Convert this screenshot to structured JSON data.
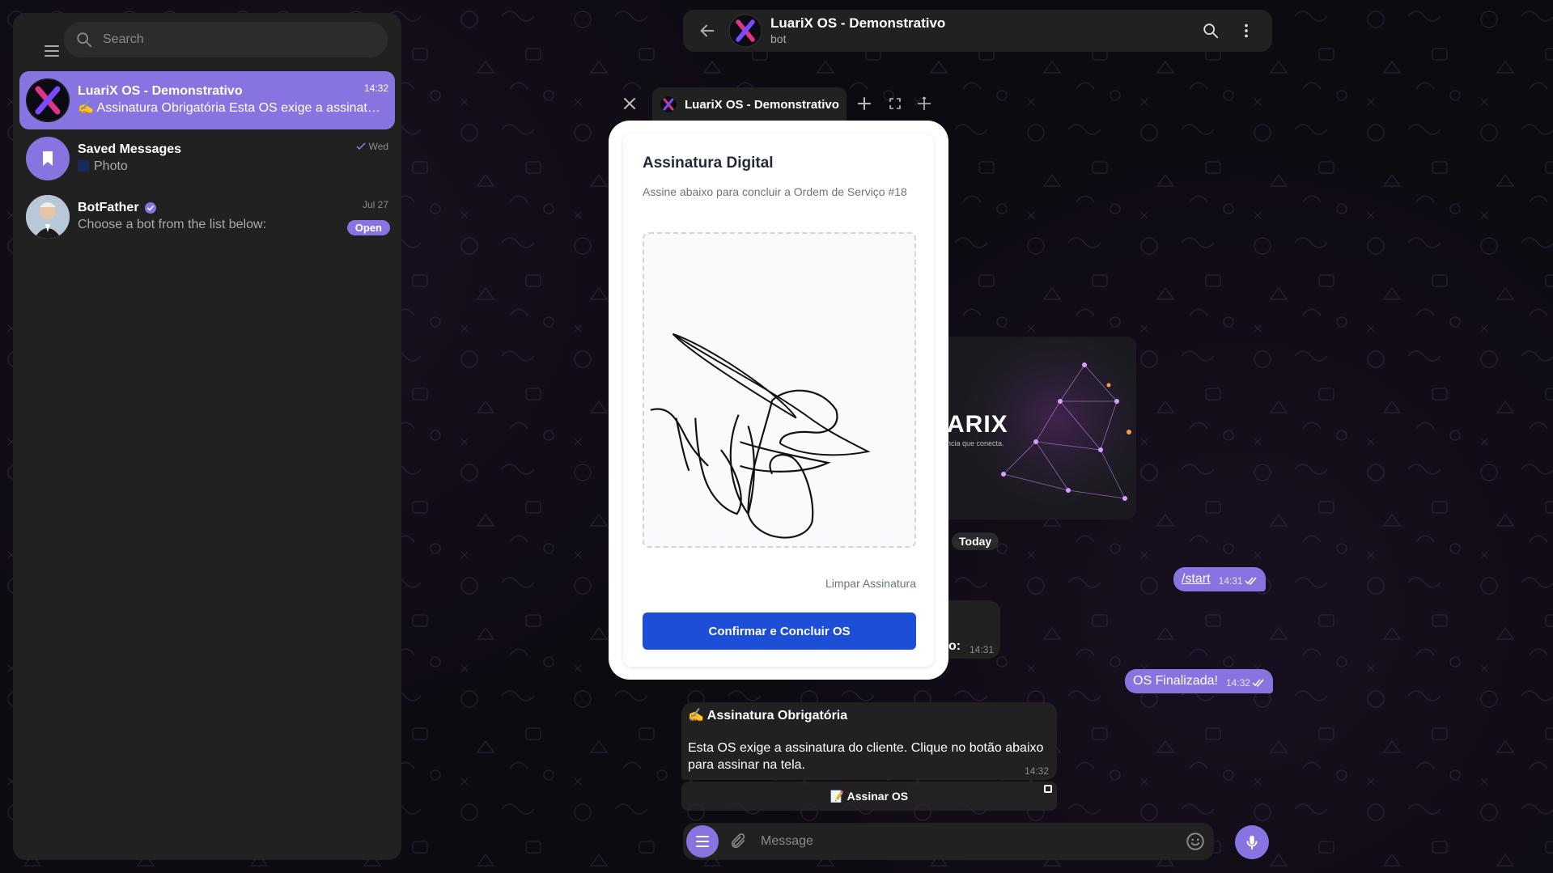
{
  "sidebar": {
    "search_placeholder": "Search",
    "chats": [
      {
        "title": "LuariX OS - Demonstrativo",
        "preview": "✍️ Assinatura Obrigatória Esta OS exige a assinatura do cliente. Clique no botão abaixo para assinar na tela.",
        "time": "14:32",
        "active": true
      },
      {
        "title": "Saved Messages",
        "preview": "Photo",
        "time": "Wed",
        "active": false
      },
      {
        "title": "BotFather",
        "preview": "Choose a bot from the list below:",
        "time": "Jul 27",
        "badge": "Open",
        "active": false
      }
    ]
  },
  "header": {
    "title": "LuariX OS - Demonstrativo",
    "subtitle": "bot"
  },
  "messages": {
    "image_text": "ARIX",
    "image_tagline": "ncia que conecta.",
    "date": "Today",
    "start_cmd": "/start",
    "start_time": "14:31",
    "partial_fragment": "o:",
    "partial_time": "14:31",
    "finalized": "OS Finalizada!",
    "finalized_time": "14:32",
    "signature_title": "✍️ Assinatura Obrigatória",
    "signature_body": "Esta OS exige a assinatura do cliente. Clique no botão abaixo para assinar na tela.",
    "signature_time": "14:32",
    "inline_button": "📝 Assinar OS"
  },
  "composer": {
    "placeholder": "Message"
  },
  "popup": {
    "tab_label": "LuariX OS - Demonstrativo",
    "title": "Assinatura Digital",
    "subtitle": "Assine abaixo para concluir a Ordem de Serviço #18",
    "clear_label": "Limpar Assinatura",
    "confirm_label": "Confirmar e Concluir OS"
  },
  "colors": {
    "accent": "#8774e1",
    "panel": "#212121",
    "confirm": "#1d4ed8"
  }
}
